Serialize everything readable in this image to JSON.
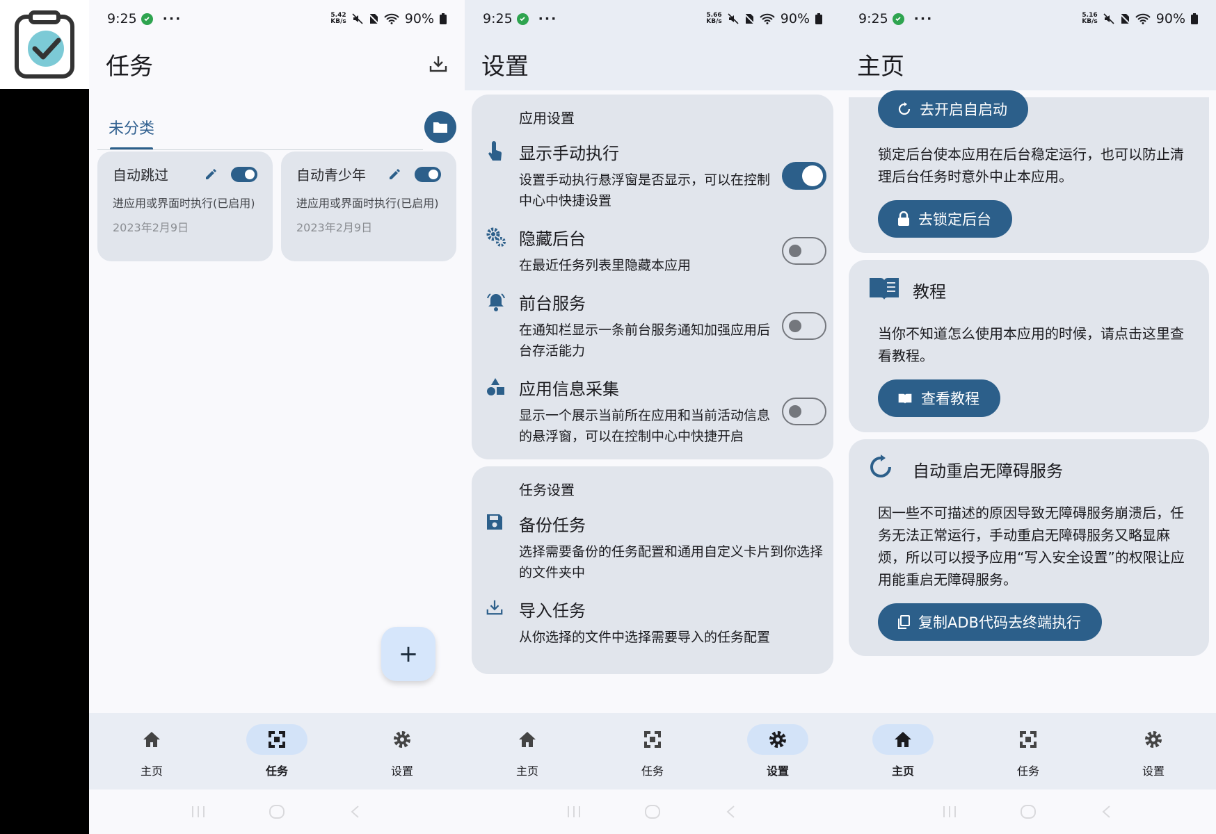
{
  "status": {
    "time": "9:25",
    "battery": "90%",
    "speeds": [
      [
        "5.42",
        "KB/s"
      ],
      [
        "5.66",
        "KB/s"
      ],
      [
        "5.16",
        "KB/s"
      ]
    ]
  },
  "nav": {
    "home": "主页",
    "tasks": "任务",
    "settings": "设置"
  },
  "tasks": {
    "title": "任务",
    "tab": "未分类",
    "cards": [
      {
        "name": "自动跳过",
        "desc": "进应用或界面时执行(已启用)",
        "date": "2023年2月9日"
      },
      {
        "name": "自动青少年",
        "desc": "进应用或界面时执行(已启用)",
        "date": "2023年2月9日"
      }
    ],
    "fab": "+"
  },
  "settings": {
    "title": "设置",
    "app_section": "应用设置",
    "items": [
      {
        "title": "显示手动执行",
        "desc": "设置手动执行悬浮窗是否显示，可以在控制中心中快捷设置",
        "on": true
      },
      {
        "title": "隐藏后台",
        "desc": "在最近任务列表里隐藏本应用",
        "on": false
      },
      {
        "title": "前台服务",
        "desc": "在通知栏显示一条前台服务通知加强应用后台存活能力",
        "on": false
      },
      {
        "title": "应用信息采集",
        "desc": "显示一个展示当前所在应用和当前活动信息的悬浮窗，可以在控制中心中快捷开启",
        "on": false
      }
    ],
    "task_section": "任务设置",
    "task_items": [
      {
        "title": "备份任务",
        "desc": "选择需要备份的任务配置和通用自定义卡片到你选择的文件夹中"
      },
      {
        "title": "导入任务",
        "desc": "从你选择的文件中选择需要导入的任务配置"
      }
    ]
  },
  "home": {
    "title": "主页",
    "autostart_btn": "去开启自启动",
    "lock_desc": "锁定后台使本应用在后台稳定运行，也可以防止清理后台任务时意外中止本应用。",
    "lock_btn": "去锁定后台",
    "tutorial_title": "教程",
    "tutorial_desc": "当你不知道怎么使用本应用的时候，请点击这里查看教程。",
    "tutorial_btn": "查看教程",
    "restart_title": "自动重启无障碍服务",
    "restart_desc": "因一些不可描述的原因导致无障碍服务崩溃后，任务无法正常运行，手动重启无障碍服务又略显麻烦，所以可以授予应用“写入安全设置”的权限让应用能重启无障碍服务。",
    "restart_btn": "复制ADB代码去终端执行"
  }
}
